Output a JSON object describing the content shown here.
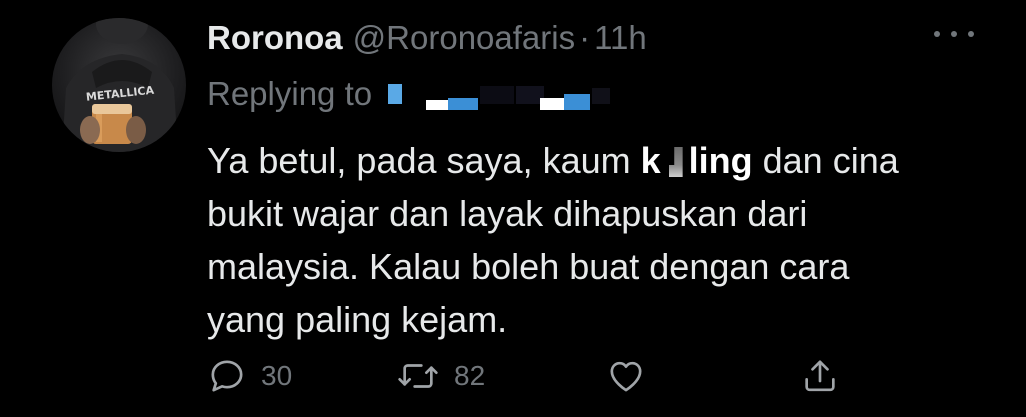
{
  "tweet": {
    "display_name": "Roronoa",
    "handle": "@Roronoafaris",
    "separator": "·",
    "time": "11h",
    "replying_prefix": "Replying to",
    "body": {
      "line1_a": "Ya betul, pada saya, kaum ",
      "line1_b1": "k",
      "line1_b2": "ling",
      "line1_c": " dan cina",
      "line2": "bukit wajar dan layak dihapuskan dari",
      "line3": "malaysia. Kalau boleh buat dengan cara",
      "line4": "yang paling kejam."
    },
    "actions": {
      "reply_count": "30",
      "retweet_count": "82"
    },
    "icons": {
      "reply": "reply-icon",
      "retweet": "retweet-icon",
      "like": "heart-icon",
      "share": "share-icon",
      "more": "more-icon"
    }
  },
  "colors": {
    "background": "#000000",
    "text": "#e7e9ea",
    "muted": "#71767b",
    "redaction_blue": "#3b8fd6"
  }
}
